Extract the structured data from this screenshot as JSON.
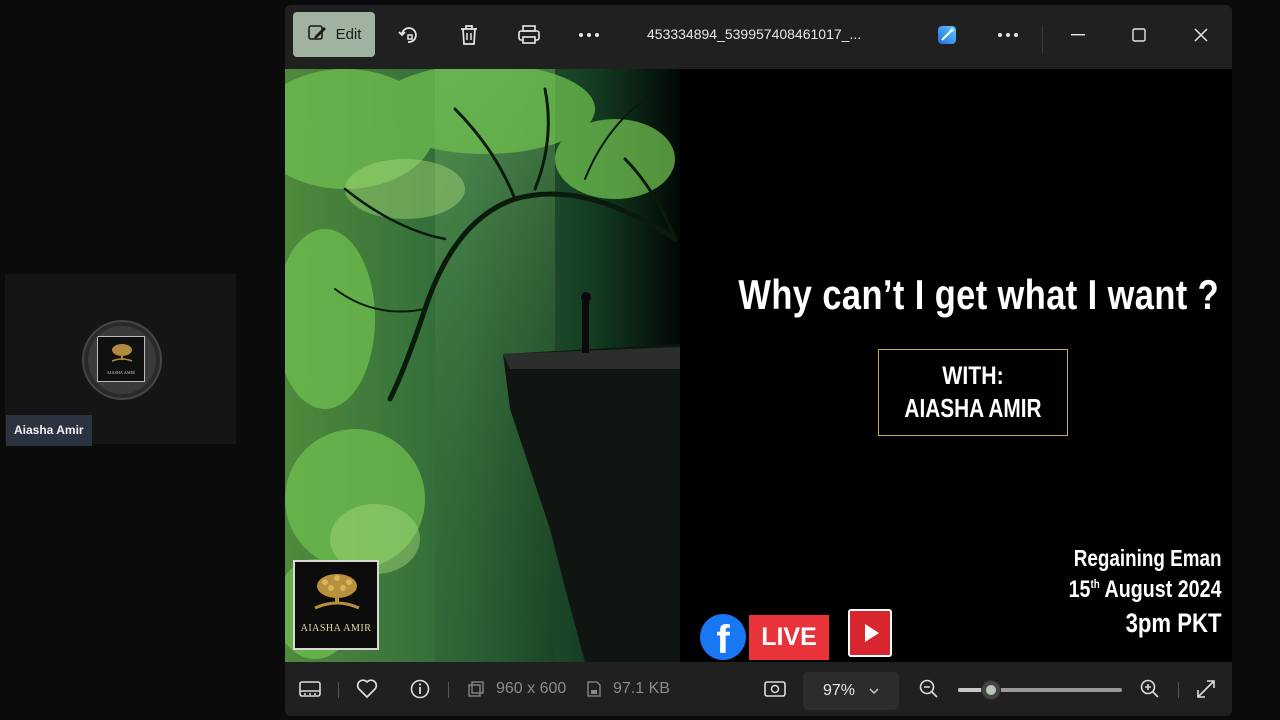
{
  "participant": {
    "name": "Aiasha Amir",
    "avatar_text": "AIASHA AMIR"
  },
  "window": {
    "toolbar": {
      "edit_label": "Edit",
      "file_title": "453334894_539957408461017_..."
    },
    "image": {
      "headline": "Why can’t I get what I want ?",
      "with_label": "WITH:",
      "speaker": "AIASHA AMIR",
      "event_name": "Regaining Eman",
      "event_day": "15",
      "event_day_suffix": "th",
      "event_month_year": " August 2024",
      "event_time": "3pm PKT",
      "logo_text": "AIASHA AMIR",
      "live_label": "LIVE",
      "fb_glyph": "f"
    },
    "statusbar": {
      "dimensions": "960 x 600",
      "file_size": "97.1 KB",
      "zoom": "97%",
      "zoom_fraction": 0.2
    }
  },
  "icons": [
    "edit-icon",
    "rotate-icon",
    "delete-icon",
    "print-icon",
    "more-icon",
    "designer-icon",
    "minimize-icon",
    "maximize-icon",
    "close-icon",
    "filmstrip-icon",
    "favorite-icon",
    "info-icon",
    "dimensions-icon",
    "filesize-icon",
    "fit-icon",
    "chevron-down-icon",
    "zoom-out-icon",
    "zoom-in-icon",
    "fullscreen-icon"
  ],
  "colors": {
    "accent": "#9fb3a0",
    "live_red": "#e8333a",
    "facebook_blue": "#1877f2",
    "youtube_red": "#d8262e",
    "frame_gold": "#c4a94c"
  }
}
